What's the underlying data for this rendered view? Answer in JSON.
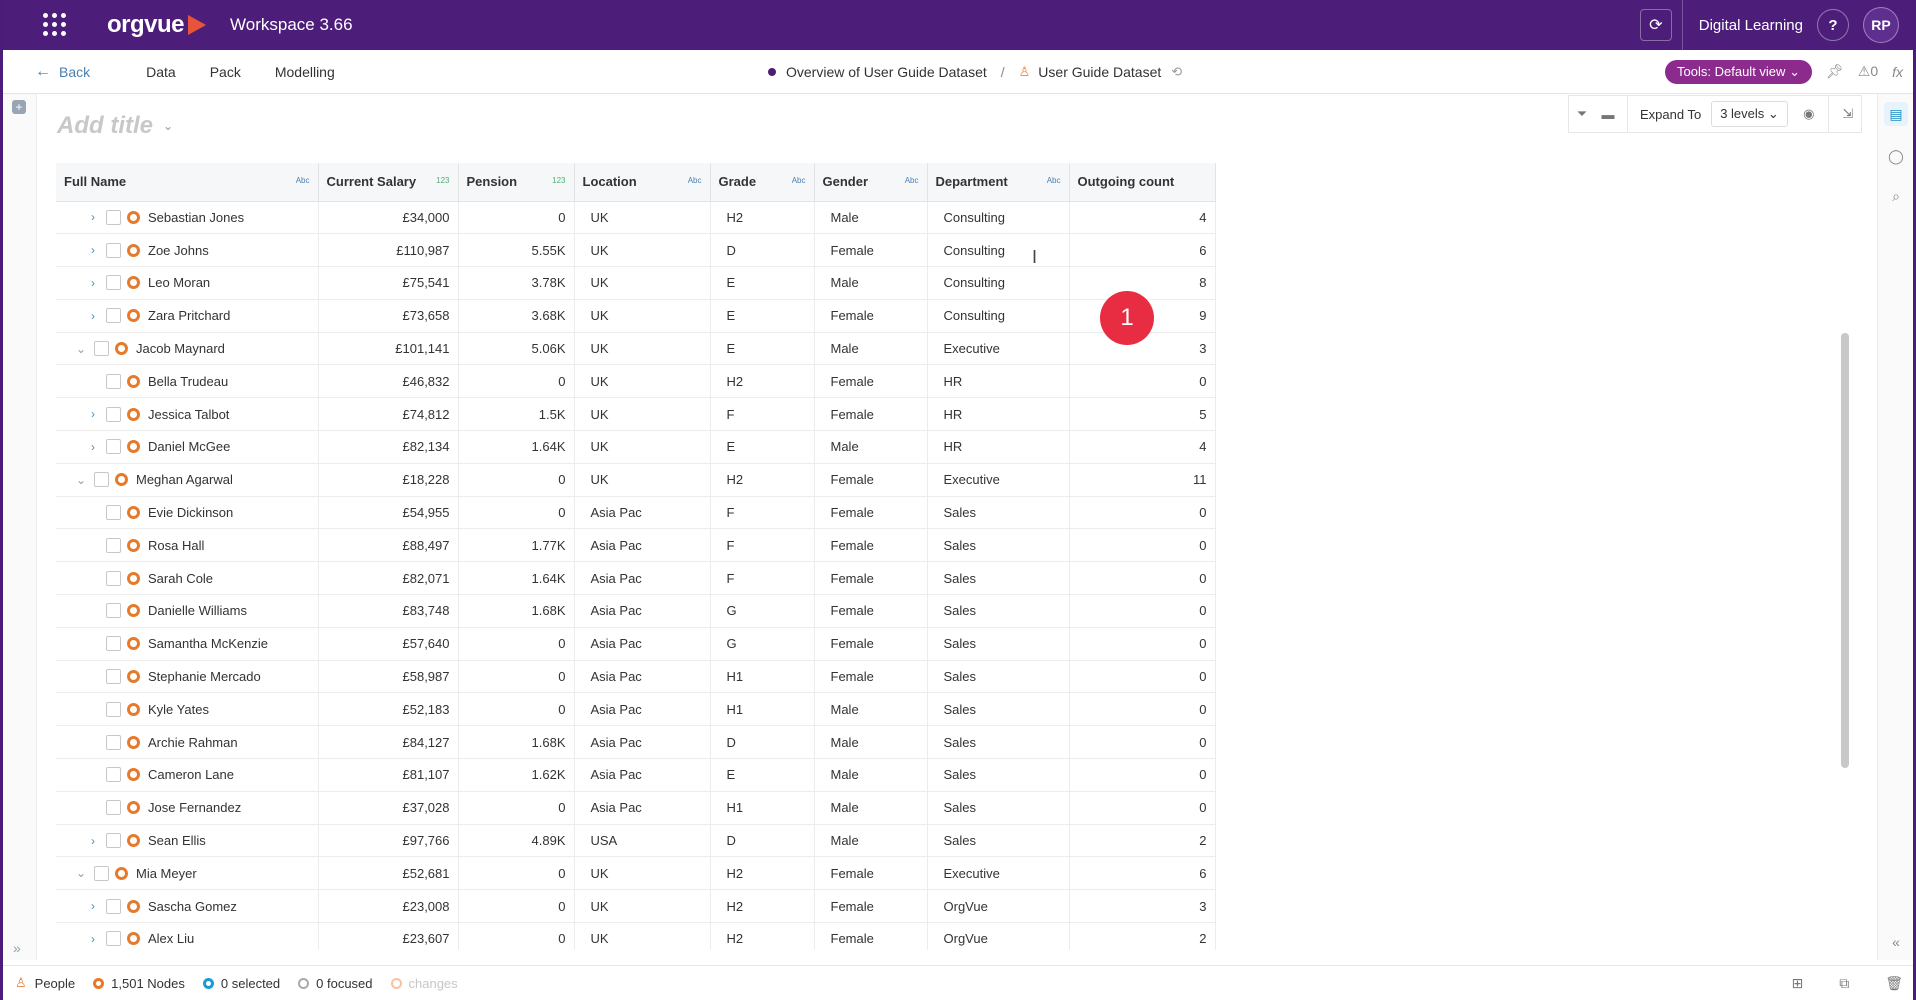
{
  "topbar": {
    "logo_text": "orgvue",
    "workspace": "Workspace 3.66",
    "sync_icon": "sync-icon",
    "digital_learning": "Digital Learning",
    "help_label": "?",
    "avatar_initials": "RP"
  },
  "nav": {
    "back_label": "Back",
    "items": [
      "Data",
      "Pack",
      "Modelling"
    ],
    "breadcrumb": [
      "Overview of User Guide Dataset",
      "User Guide Dataset"
    ],
    "breadcrumb_sep": "/",
    "tools_label": "Tools: Default view",
    "count_label": "0",
    "fx_label": "fx"
  },
  "view": {
    "title_placeholder": "Add title",
    "expand_label": "Expand To",
    "levels_value": "3 levels"
  },
  "grid": {
    "columns": [
      {
        "label": "Full Name",
        "type": "Abc"
      },
      {
        "label": "Current Salary",
        "type": "123"
      },
      {
        "label": "Pension",
        "type": "123"
      },
      {
        "label": "Location",
        "type": "Abc"
      },
      {
        "label": "Grade",
        "type": "Abc"
      },
      {
        "label": "Gender",
        "type": "Abc"
      },
      {
        "label": "Department",
        "type": "Abc"
      },
      {
        "label": "Outgoing count",
        "type": ""
      }
    ],
    "rows": [
      {
        "level": 2,
        "expand": "closed",
        "name": "Sebastian Jones",
        "salary": "£34,000",
        "pension": "0",
        "location": "UK",
        "grade": "H2",
        "gender": "Male",
        "department": "Consulting",
        "outgoing": "4"
      },
      {
        "level": 2,
        "expand": "closed",
        "name": "Zoe Johns",
        "salary": "£110,987",
        "pension": "5.55K",
        "location": "UK",
        "grade": "D",
        "gender": "Female",
        "department": "Consulting",
        "outgoing": "6"
      },
      {
        "level": 2,
        "expand": "closed",
        "name": "Leo Moran",
        "salary": "£75,541",
        "pension": "3.78K",
        "location": "UK",
        "grade": "E",
        "gender": "Male",
        "department": "Consulting",
        "outgoing": "8"
      },
      {
        "level": 2,
        "expand": "closed",
        "name": "Zara Pritchard",
        "salary": "£73,658",
        "pension": "3.68K",
        "location": "UK",
        "grade": "E",
        "gender": "Female",
        "department": "Consulting",
        "outgoing": "9"
      },
      {
        "level": 1,
        "expand": "open",
        "name": "Jacob Maynard",
        "salary": "£101,141",
        "pension": "5.06K",
        "location": "UK",
        "grade": "E",
        "gender": "Male",
        "department": "Executive",
        "outgoing": "3"
      },
      {
        "level": 2,
        "expand": "none",
        "name": "Bella Trudeau",
        "salary": "£46,832",
        "pension": "0",
        "location": "UK",
        "grade": "H2",
        "gender": "Female",
        "department": "HR",
        "outgoing": "0"
      },
      {
        "level": 2,
        "expand": "closed",
        "name": "Jessica Talbot",
        "salary": "£74,812",
        "pension": "1.5K",
        "location": "UK",
        "grade": "F",
        "gender": "Female",
        "department": "HR",
        "outgoing": "5"
      },
      {
        "level": 2,
        "expand": "closed",
        "name": "Daniel McGee",
        "salary": "£82,134",
        "pension": "1.64K",
        "location": "UK",
        "grade": "E",
        "gender": "Male",
        "department": "HR",
        "outgoing": "4"
      },
      {
        "level": 1,
        "expand": "open",
        "name": "Meghan Agarwal",
        "salary": "£18,228",
        "pension": "0",
        "location": "UK",
        "grade": "H2",
        "gender": "Female",
        "department": "Executive",
        "outgoing": "11"
      },
      {
        "level": 2,
        "expand": "none",
        "name": "Evie Dickinson",
        "salary": "£54,955",
        "pension": "0",
        "location": "Asia Pac",
        "grade": "F",
        "gender": "Female",
        "department": "Sales",
        "outgoing": "0"
      },
      {
        "level": 2,
        "expand": "none",
        "name": "Rosa Hall",
        "salary": "£88,497",
        "pension": "1.77K",
        "location": "Asia Pac",
        "grade": "F",
        "gender": "Female",
        "department": "Sales",
        "outgoing": "0"
      },
      {
        "level": 2,
        "expand": "none",
        "name": "Sarah Cole",
        "salary": "£82,071",
        "pension": "1.64K",
        "location": "Asia Pac",
        "grade": "F",
        "gender": "Female",
        "department": "Sales",
        "outgoing": "0"
      },
      {
        "level": 2,
        "expand": "none",
        "name": "Danielle Williams",
        "salary": "£83,748",
        "pension": "1.68K",
        "location": "Asia Pac",
        "grade": "G",
        "gender": "Female",
        "department": "Sales",
        "outgoing": "0"
      },
      {
        "level": 2,
        "expand": "none",
        "name": "Samantha McKenzie",
        "salary": "£57,640",
        "pension": "0",
        "location": "Asia Pac",
        "grade": "G",
        "gender": "Female",
        "department": "Sales",
        "outgoing": "0"
      },
      {
        "level": 2,
        "expand": "none",
        "name": "Stephanie Mercado",
        "salary": "£58,987",
        "pension": "0",
        "location": "Asia Pac",
        "grade": "H1",
        "gender": "Female",
        "department": "Sales",
        "outgoing": "0"
      },
      {
        "level": 2,
        "expand": "none",
        "name": "Kyle Yates",
        "salary": "£52,183",
        "pension": "0",
        "location": "Asia Pac",
        "grade": "H1",
        "gender": "Male",
        "department": "Sales",
        "outgoing": "0"
      },
      {
        "level": 2,
        "expand": "none",
        "name": "Archie Rahman",
        "salary": "£84,127",
        "pension": "1.68K",
        "location": "Asia Pac",
        "grade": "D",
        "gender": "Male",
        "department": "Sales",
        "outgoing": "0"
      },
      {
        "level": 2,
        "expand": "none",
        "name": "Cameron Lane",
        "salary": "£81,107",
        "pension": "1.62K",
        "location": "Asia Pac",
        "grade": "E",
        "gender": "Male",
        "department": "Sales",
        "outgoing": "0"
      },
      {
        "level": 2,
        "expand": "none",
        "name": "Jose Fernandez",
        "salary": "£37,028",
        "pension": "0",
        "location": "Asia Pac",
        "grade": "H1",
        "gender": "Male",
        "department": "Sales",
        "outgoing": "0"
      },
      {
        "level": 2,
        "expand": "closed",
        "name": "Sean Ellis",
        "salary": "£97,766",
        "pension": "4.89K",
        "location": "USA",
        "grade": "D",
        "gender": "Male",
        "department": "Sales",
        "outgoing": "2"
      },
      {
        "level": 1,
        "expand": "open",
        "name": "Mia Meyer",
        "salary": "£52,681",
        "pension": "0",
        "location": "UK",
        "grade": "H2",
        "gender": "Female",
        "department": "Executive",
        "outgoing": "6"
      },
      {
        "level": 2,
        "expand": "closed",
        "name": "Sascha Gomez",
        "salary": "£23,008",
        "pension": "0",
        "location": "UK",
        "grade": "H2",
        "gender": "Female",
        "department": "OrgVue",
        "outgoing": "3"
      },
      {
        "level": 2,
        "expand": "closed",
        "name": "Alex Liu",
        "salary": "£23,607",
        "pension": "0",
        "location": "UK",
        "grade": "H2",
        "gender": "Female",
        "department": "OrgVue",
        "outgoing": "2"
      }
    ]
  },
  "badge": {
    "value": "1"
  },
  "status": {
    "dataset": "People",
    "nodes": "1,501 Nodes",
    "selected": "0 selected",
    "focused": "0 focused",
    "changes": "changes"
  },
  "colors": {
    "topbar": "#4c1e79",
    "accent_tools": "#8c2a8d",
    "node_ring": "#e67a2a",
    "badge": "#e82d43",
    "link": "#4a7fb3"
  }
}
